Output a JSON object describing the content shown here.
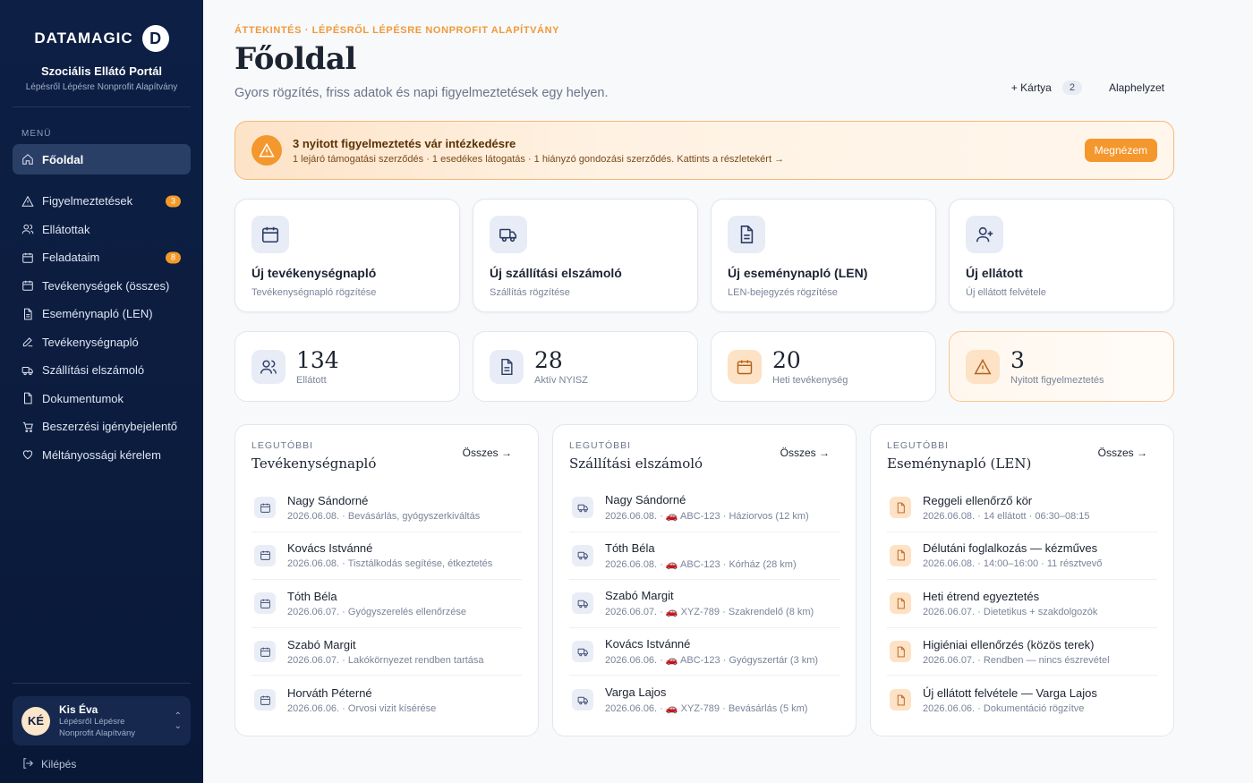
{
  "brand": {
    "wordmark": "DATAMAGIC",
    "logo_letter": "D",
    "portal": "Szociális Ellátó Portál",
    "org": "Lépésről Lépésre Nonprofit Alapítvány"
  },
  "sidebar": {
    "menu_label": "MENÜ",
    "home": "Főoldal",
    "items": [
      {
        "label": "Figyelmeztetések",
        "icon": "alert-triangle-icon",
        "badge": "3"
      },
      {
        "label": "Ellátottak",
        "icon": "users-icon",
        "badge": ""
      },
      {
        "label": "Feladataim",
        "icon": "calendar-icon",
        "badge": "8"
      },
      {
        "label": "Tevékenységek (összes)",
        "icon": "calendar-icon",
        "badge": ""
      },
      {
        "label": "Eseménynapló (LEN)",
        "icon": "file-text-icon",
        "badge": ""
      },
      {
        "label": "Tevékenységnapló",
        "icon": "pen-icon",
        "badge": ""
      },
      {
        "label": "Szállítási elszámoló",
        "icon": "truck-icon",
        "badge": ""
      },
      {
        "label": "Dokumentumok",
        "icon": "file-icon",
        "badge": ""
      },
      {
        "label": "Beszerzési igénybejelentő",
        "icon": "cart-icon",
        "badge": ""
      },
      {
        "label": "Méltányossági kérelem",
        "icon": "heart-icon",
        "badge": ""
      }
    ],
    "user": {
      "initials": "KÉ",
      "name": "Kis Éva",
      "org": "Lépésről Lépésre Nonprofit Alapítvány"
    },
    "logout": "Kilépés"
  },
  "header": {
    "eyebrow": "ÁTTEKINTÉS · LÉPÉSRŐL LÉPÉSRE NONPROFIT ALAPÍTVÁNY",
    "title": "Főoldal",
    "subtitle": "Gyors rögzítés, friss adatok és napi figyelmeztetések egy helyen.",
    "add_card": "+ Kártya",
    "card_count": "2",
    "reset": "Alaphelyzet"
  },
  "alert": {
    "title": "3 nyitott figyelmeztetés vár intézkedésre",
    "text": "1 lejáró támogatási szerződés · 1 esedékes látogatás · 1 hiányzó gondozási szerződés. Kattints a részletekért →",
    "button": "Megnézem"
  },
  "quick": [
    {
      "title": "Új tevékenységnapló",
      "sub": "Tevékenységnapló rögzítése",
      "icon": "calendar-icon"
    },
    {
      "title": "Új szállítási elszámoló",
      "sub": "Szállítás rögzítése",
      "icon": "truck-icon"
    },
    {
      "title": "Új eseménynapló (LEN)",
      "sub": "LEN-bejegyzés rögzítése",
      "icon": "file-text-icon"
    },
    {
      "title": "Új ellátott",
      "sub": "Új ellátott felvétele",
      "icon": "user-plus-icon"
    }
  ],
  "stats": [
    {
      "value": "134",
      "label": "Ellátott",
      "icon": "users-icon"
    },
    {
      "value": "28",
      "label": "Aktív NYISZ",
      "icon": "file-text-icon"
    },
    {
      "value": "20",
      "label": "Heti tevékenység",
      "icon": "calendar-icon"
    },
    {
      "value": "3",
      "label": "Nyitott figyelmeztetés",
      "icon": "alert-triangle-icon"
    }
  ],
  "lists": [
    {
      "kicker": "LEGUTÓBBI",
      "title": "Tevékenységnapló",
      "all": "Összes →",
      "rows": [
        {
          "name": "Nagy Sándorné",
          "meta": "2026.06.08. · Bevásárlás, gyógyszerkiváltás"
        },
        {
          "name": "Kovács Istvánné",
          "meta": "2026.06.08. · Tisztálkodás segítése, étkeztetés"
        },
        {
          "name": "Tóth Béla",
          "meta": "2026.06.07. · Gyógyszerelés ellenőrzése"
        },
        {
          "name": "Szabó Margit",
          "meta": "2026.06.07. · Lakókörnyezet rendben tartása"
        },
        {
          "name": "Horváth Péterné",
          "meta": "2026.06.06. · Orvosi vizit kísérése"
        }
      ]
    },
    {
      "kicker": "LEGUTÓBBI",
      "title": "Szállítási elszámoló",
      "all": "Összes →",
      "rows": [
        {
          "name": "Nagy Sándorné",
          "meta": "2026.06.08. · 🚗 ABC-123 · Háziorvos (12 km)"
        },
        {
          "name": "Tóth Béla",
          "meta": "2026.06.08. · 🚗 ABC-123 · Kórház (28 km)"
        },
        {
          "name": "Szabó Margit",
          "meta": "2026.06.07. · 🚗 XYZ-789 · Szakrendelő (8 km)"
        },
        {
          "name": "Kovács Istvánné",
          "meta": "2026.06.06. · 🚗 ABC-123 · Gyógyszertár (3 km)"
        },
        {
          "name": "Varga Lajos",
          "meta": "2026.06.06. · 🚗 XYZ-789 · Bevásárlás (5 km)"
        }
      ]
    },
    {
      "kicker": "LEGUTÓBBI",
      "title": "Eseménynapló (LEN)",
      "all": "Összes →",
      "rows": [
        {
          "name": "Reggeli ellenőrző kör",
          "meta": "2026.06.08. · 14 ellátott · 06:30–08:15"
        },
        {
          "name": "Délutáni foglalkozás — kézműves",
          "meta": "2026.06.08. · 14:00–16:00 · 11 résztvevő"
        },
        {
          "name": "Heti étrend egyeztetés",
          "meta": "2026.06.07. · Dietetikus + szakdolgozók"
        },
        {
          "name": "Higiéniai ellenőrzés (közös terek)",
          "meta": "2026.06.07. · Rendben — nincs észrevétel"
        },
        {
          "name": "Új ellátott felvétele — Varga Lajos",
          "meta": "2026.06.06. · Dokumentáció rögzítve"
        }
      ]
    }
  ],
  "colors": {
    "sidebar": "#0d1f45",
    "accent": "#f4972c"
  }
}
